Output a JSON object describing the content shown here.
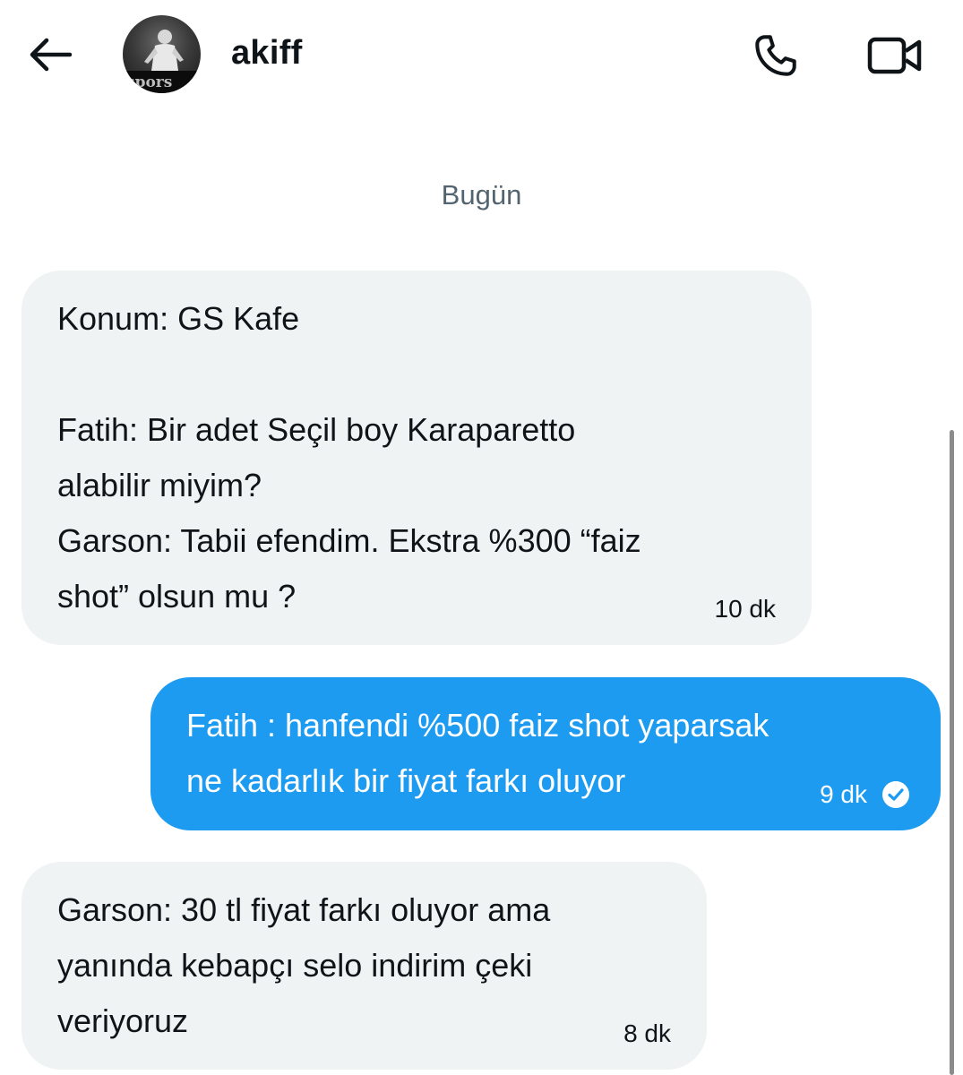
{
  "header": {
    "username": "akiff",
    "back_icon": "arrow-left-icon",
    "call_icon": "phone-icon",
    "video_icon": "video-camera-icon",
    "avatar_icon": "user-avatar"
  },
  "date_separator": "Bugün",
  "messages": [
    {
      "direction": "incoming",
      "text": "Konum: GS Kafe\n\nFatih: Bir adet Seçil boy Karaparetto\nalabilir miyim?\nGarson: Tabii efendim. Ekstra %300 “faiz\nshot” olsun mu ?",
      "time": "10 dk"
    },
    {
      "direction": "outgoing",
      "text": "Fatih : hanfendi %500 faiz shot yaparsak\nne kadarlık bir fiyat farkı oluyor",
      "time": "9 dk",
      "status_icon": "check-circle-icon"
    },
    {
      "direction": "incoming",
      "text": "Garson: 30 tl fiyat farkı oluyor ama\nyanında kebapçı selo indirim çeki\nveriyoruz",
      "time": "8 dk"
    }
  ],
  "colors": {
    "incoming_bubble": "#eff3f4",
    "outgoing_bubble": "#1d9bf0",
    "date_text": "#536471"
  }
}
